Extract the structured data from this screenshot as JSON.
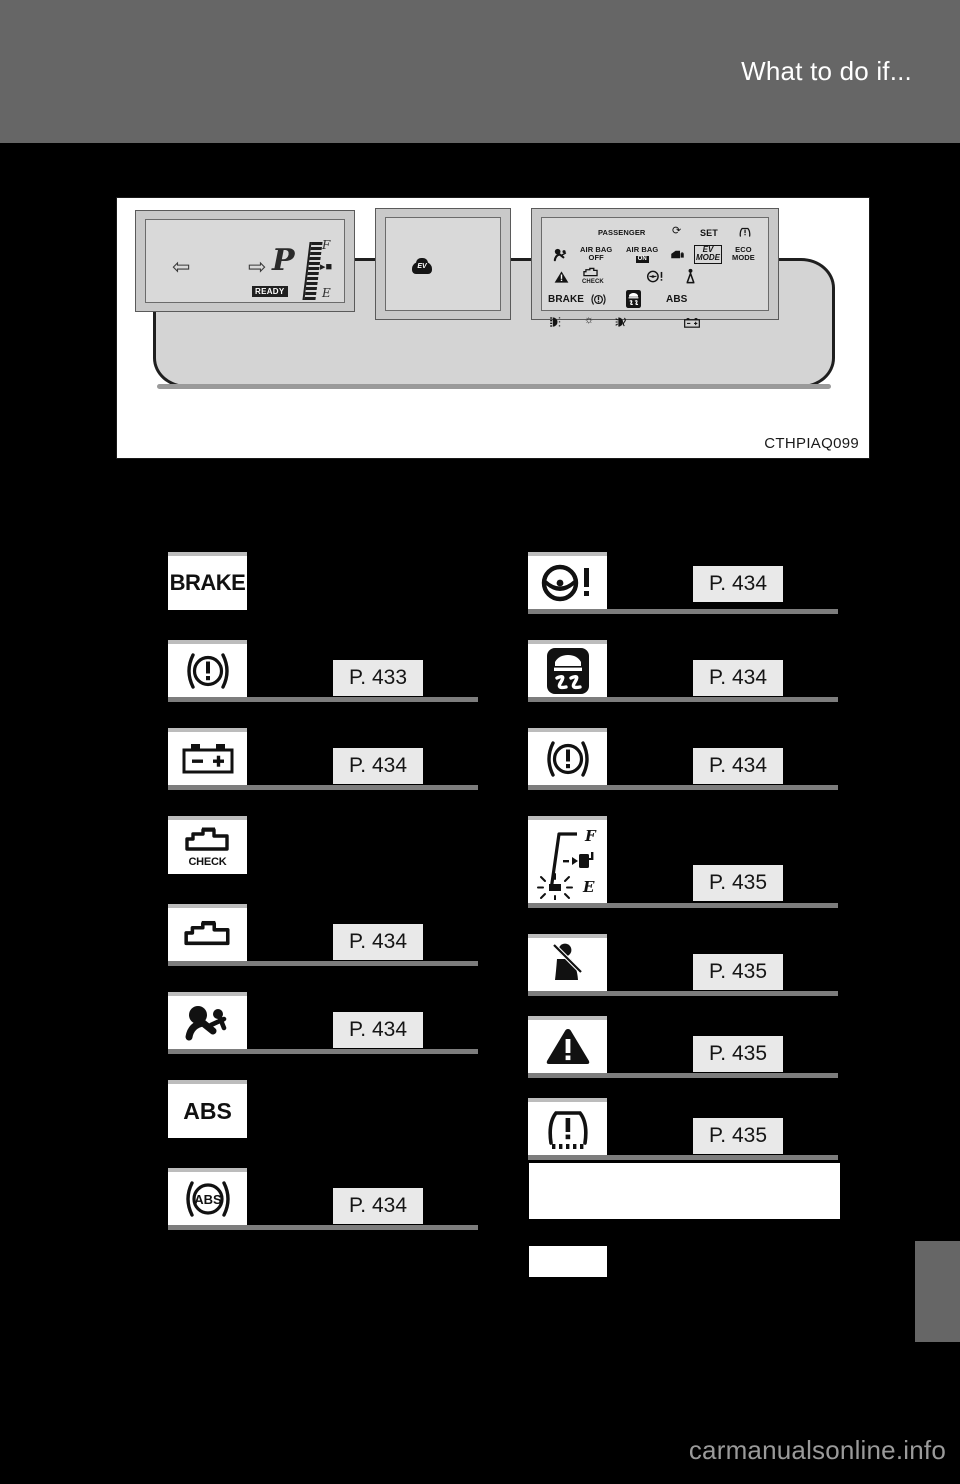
{
  "header": {
    "title": "What to do if..."
  },
  "illustration": {
    "code": "CTHPIAQ099",
    "name": "instrument-cluster-diagram",
    "left_display": {
      "turn_left_icon": "arrow-left-icon",
      "turn_right_icon": "arrow-right-icon",
      "shift_position": "P",
      "ready_badge": "READY",
      "fuel_full_label": "F",
      "fuel_empty_label": "E",
      "fuel_pump_icon": "fuel-pump-icon"
    },
    "center_display": {
      "ev_badge": "EV"
    },
    "right_indicators": {
      "row1": [
        "PASSENGER",
        "slip-indicator-icon",
        "SET",
        "tire-pressure-icon"
      ],
      "row2_labels": [
        "AIR BAG",
        "OFF",
        "AIR BAG",
        "ON",
        "EV",
        "MODE",
        "ECO",
        "MODE"
      ],
      "row2": [
        "airbag-passenger-icon",
        "AIR BAG OFF",
        "AIR BAG ON",
        "door-open-icon",
        "EV MODE",
        "ECO MODE"
      ],
      "row3": [
        "warning-triangle-icon",
        "CHECK",
        "power-steering-icon",
        "seat-belt-rear-icon"
      ],
      "row4": [
        "BRAKE",
        "brake-circle-icon",
        "vsc-skid-icon",
        "ABS"
      ],
      "row5": [
        "headlight-icon",
        "taillight-icon",
        "fog-light-icon",
        "battery-icon"
      ]
    }
  },
  "left_column": [
    {
      "icon": "brake-text-icon",
      "label": "BRAKE",
      "page": ""
    },
    {
      "icon": "brake-circle-icon",
      "label": "",
      "page": "P. 433"
    },
    {
      "icon": "battery-icon",
      "label": "",
      "page": "P. 434"
    },
    {
      "icon": "engine-check-icon",
      "label": "CHECK",
      "page": ""
    },
    {
      "icon": "engine-icon",
      "label": "",
      "page": "P. 434"
    },
    {
      "icon": "airbag-srs-icon",
      "label": "",
      "page": "P. 434"
    },
    {
      "icon": "abs-text-icon",
      "label": "ABS",
      "page": ""
    },
    {
      "icon": "abs-circle-icon",
      "label": "",
      "page": "P. 434"
    }
  ],
  "right_column": [
    {
      "icon": "power-steering-icon",
      "label": "",
      "page": "P. 434"
    },
    {
      "icon": "vsc-skid-icon",
      "label": "",
      "page": "P. 434"
    },
    {
      "icon": "brake-circle-icon",
      "label": "",
      "page": "P. 434"
    },
    {
      "icon": "low-fuel-gauge-icon",
      "label": "",
      "page": "P. 435"
    },
    {
      "icon": "seat-belt-icon",
      "label": "",
      "page": "P. 435"
    },
    {
      "icon": "master-warning-icon",
      "label": "",
      "page": "P. 435"
    },
    {
      "icon": "tire-pressure-icon",
      "label": "",
      "page": "P. 435"
    }
  ],
  "colors": {
    "header_band": "#666666",
    "page_background": "#000000",
    "reference_box": "#e9e9e9",
    "rule": "#7d7d7d",
    "icon_box": "#ffffff"
  },
  "watermark": "carmanualsonline.info"
}
